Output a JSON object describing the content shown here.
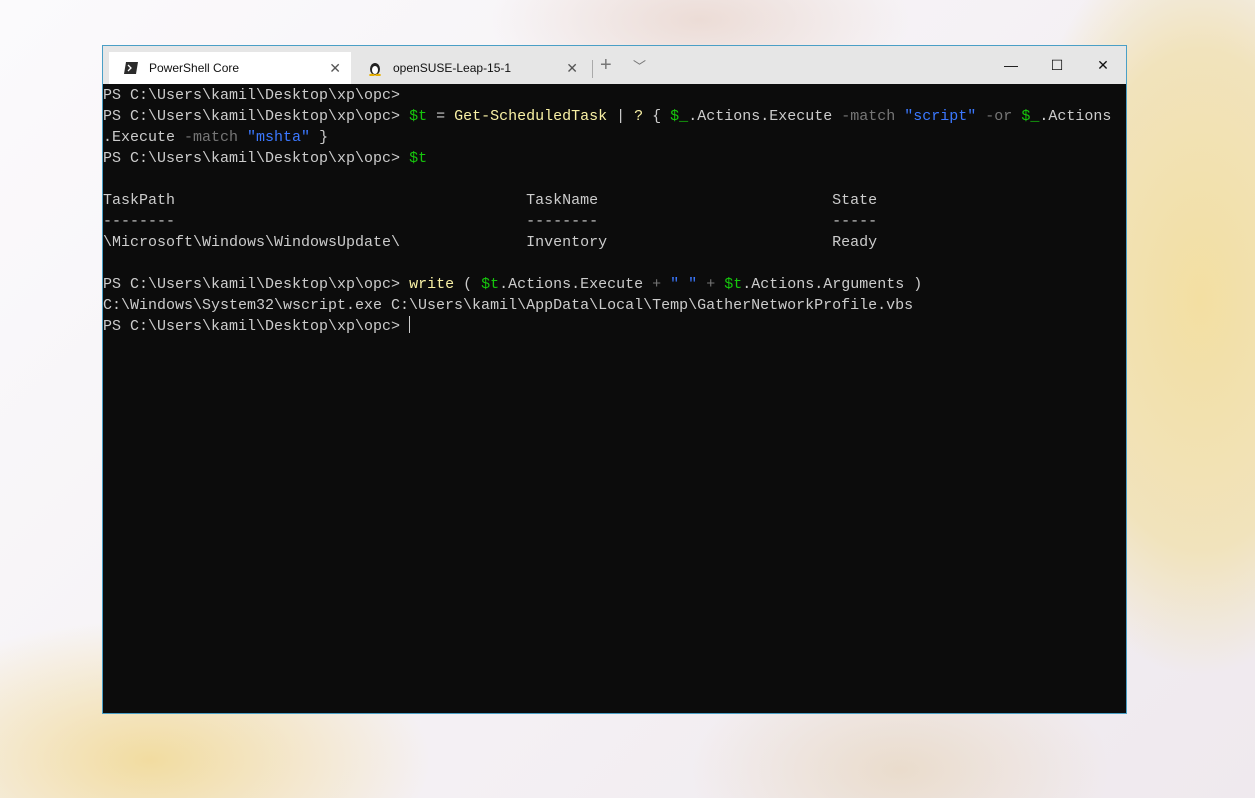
{
  "tabs": [
    {
      "label": "PowerShell Core",
      "icon": "powershell-icon",
      "active": true
    },
    {
      "label": "openSUSE-Leap-15-1",
      "icon": "linux-penguin-icon",
      "active": false
    }
  ],
  "window_controls": {
    "minimize": "—",
    "maximize": "☐",
    "close": "✕"
  },
  "terminal": {
    "lines": [
      [
        {
          "t": "PS C:\\Users\\kamil\\Desktop\\xp\\opc>",
          "k": "txt"
        }
      ],
      [
        {
          "t": "PS C:\\Users\\kamil\\Desktop\\xp\\opc> ",
          "k": "txt"
        },
        {
          "t": "$t",
          "k": "var"
        },
        {
          "t": " = ",
          "k": "txt"
        },
        {
          "t": "Get-ScheduledTask",
          "k": "cmd"
        },
        {
          "t": " | ",
          "k": "txt"
        },
        {
          "t": "?",
          "k": "cmd"
        },
        {
          "t": " { ",
          "k": "txt"
        },
        {
          "t": "$_",
          "k": "var"
        },
        {
          "t": ".Actions.Execute ",
          "k": "txt"
        },
        {
          "t": "-match",
          "k": "op"
        },
        {
          "t": " ",
          "k": "txt"
        },
        {
          "t": "\"script\"",
          "k": "str"
        },
        {
          "t": " ",
          "k": "txt"
        },
        {
          "t": "-or",
          "k": "op"
        },
        {
          "t": " ",
          "k": "txt"
        },
        {
          "t": "$_",
          "k": "var"
        },
        {
          "t": ".Actions",
          "k": "txt"
        }
      ],
      [
        {
          "t": ".Execute ",
          "k": "txt"
        },
        {
          "t": "-match",
          "k": "op"
        },
        {
          "t": " ",
          "k": "txt"
        },
        {
          "t": "\"mshta\"",
          "k": "str"
        },
        {
          "t": " }",
          "k": "txt"
        }
      ],
      [
        {
          "t": "PS C:\\Users\\kamil\\Desktop\\xp\\opc> ",
          "k": "txt"
        },
        {
          "t": "$t",
          "k": "var"
        }
      ],
      [],
      [
        {
          "t": "TaskPath                                       TaskName                          State",
          "k": "txt"
        }
      ],
      [
        {
          "t": "--------                                       --------                          -----",
          "k": "txt"
        }
      ],
      [
        {
          "t": "\\Microsoft\\Windows\\WindowsUpdate\\              Inventory                         Ready",
          "k": "txt"
        }
      ],
      [],
      [
        {
          "t": "PS C:\\Users\\kamil\\Desktop\\xp\\opc> ",
          "k": "txt"
        },
        {
          "t": "write",
          "k": "cmd"
        },
        {
          "t": " ( ",
          "k": "txt"
        },
        {
          "t": "$t",
          "k": "var"
        },
        {
          "t": ".Actions.Execute ",
          "k": "txt"
        },
        {
          "t": "+",
          "k": "op"
        },
        {
          "t": " ",
          "k": "txt"
        },
        {
          "t": "\" \"",
          "k": "str"
        },
        {
          "t": " ",
          "k": "txt"
        },
        {
          "t": "+",
          "k": "op"
        },
        {
          "t": " ",
          "k": "txt"
        },
        {
          "t": "$t",
          "k": "var"
        },
        {
          "t": ".Actions.Arguments )",
          "k": "txt"
        }
      ],
      [
        {
          "t": "C:\\Windows\\System32\\wscript.exe C:\\Users\\kamil\\AppData\\Local\\Temp\\GatherNetworkProfile.vbs",
          "k": "txt"
        }
      ],
      [
        {
          "t": "PS C:\\Users\\kamil\\Desktop\\xp\\opc> ",
          "k": "txt"
        }
      ]
    ]
  }
}
